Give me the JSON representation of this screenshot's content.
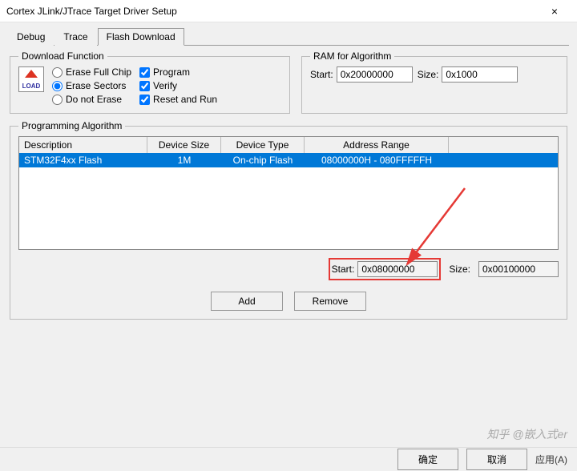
{
  "window": {
    "title": "Cortex JLink/JTrace Target Driver Setup"
  },
  "tabs": {
    "debug": "Debug",
    "trace": "Trace",
    "flash": "Flash Download"
  },
  "download_function": {
    "legend": "Download Function",
    "icon_text": "LOAD",
    "radios": {
      "full_chip": "Erase Full Chip",
      "sectors": "Erase Sectors",
      "no_erase": "Do not Erase"
    },
    "checks": {
      "program": "Program",
      "verify": "Verify",
      "reset_run": "Reset and Run"
    }
  },
  "ram_algorithm": {
    "legend": "RAM for Algorithm",
    "start_label": "Start:",
    "start_value": "0x20000000",
    "size_label": "Size:",
    "size_value": "0x1000"
  },
  "programming_algorithm": {
    "legend": "Programming Algorithm",
    "headers": {
      "desc": "Description",
      "size": "Device Size",
      "type": "Device Type",
      "addr": "Address Range"
    },
    "rows": [
      {
        "desc": "STM32F4xx Flash",
        "size": "1M",
        "type": "On-chip Flash",
        "addr": "08000000H - 080FFFFFH"
      }
    ],
    "start_label": "Start:",
    "start_value": "0x08000000",
    "size_label": "Size:",
    "size_value": "0x00100000",
    "add": "Add",
    "remove": "Remove"
  },
  "buttons": {
    "ok": "确定",
    "cancel": "取消",
    "apply": "应用(A)"
  },
  "watermark": "知乎 @嵌入式er"
}
